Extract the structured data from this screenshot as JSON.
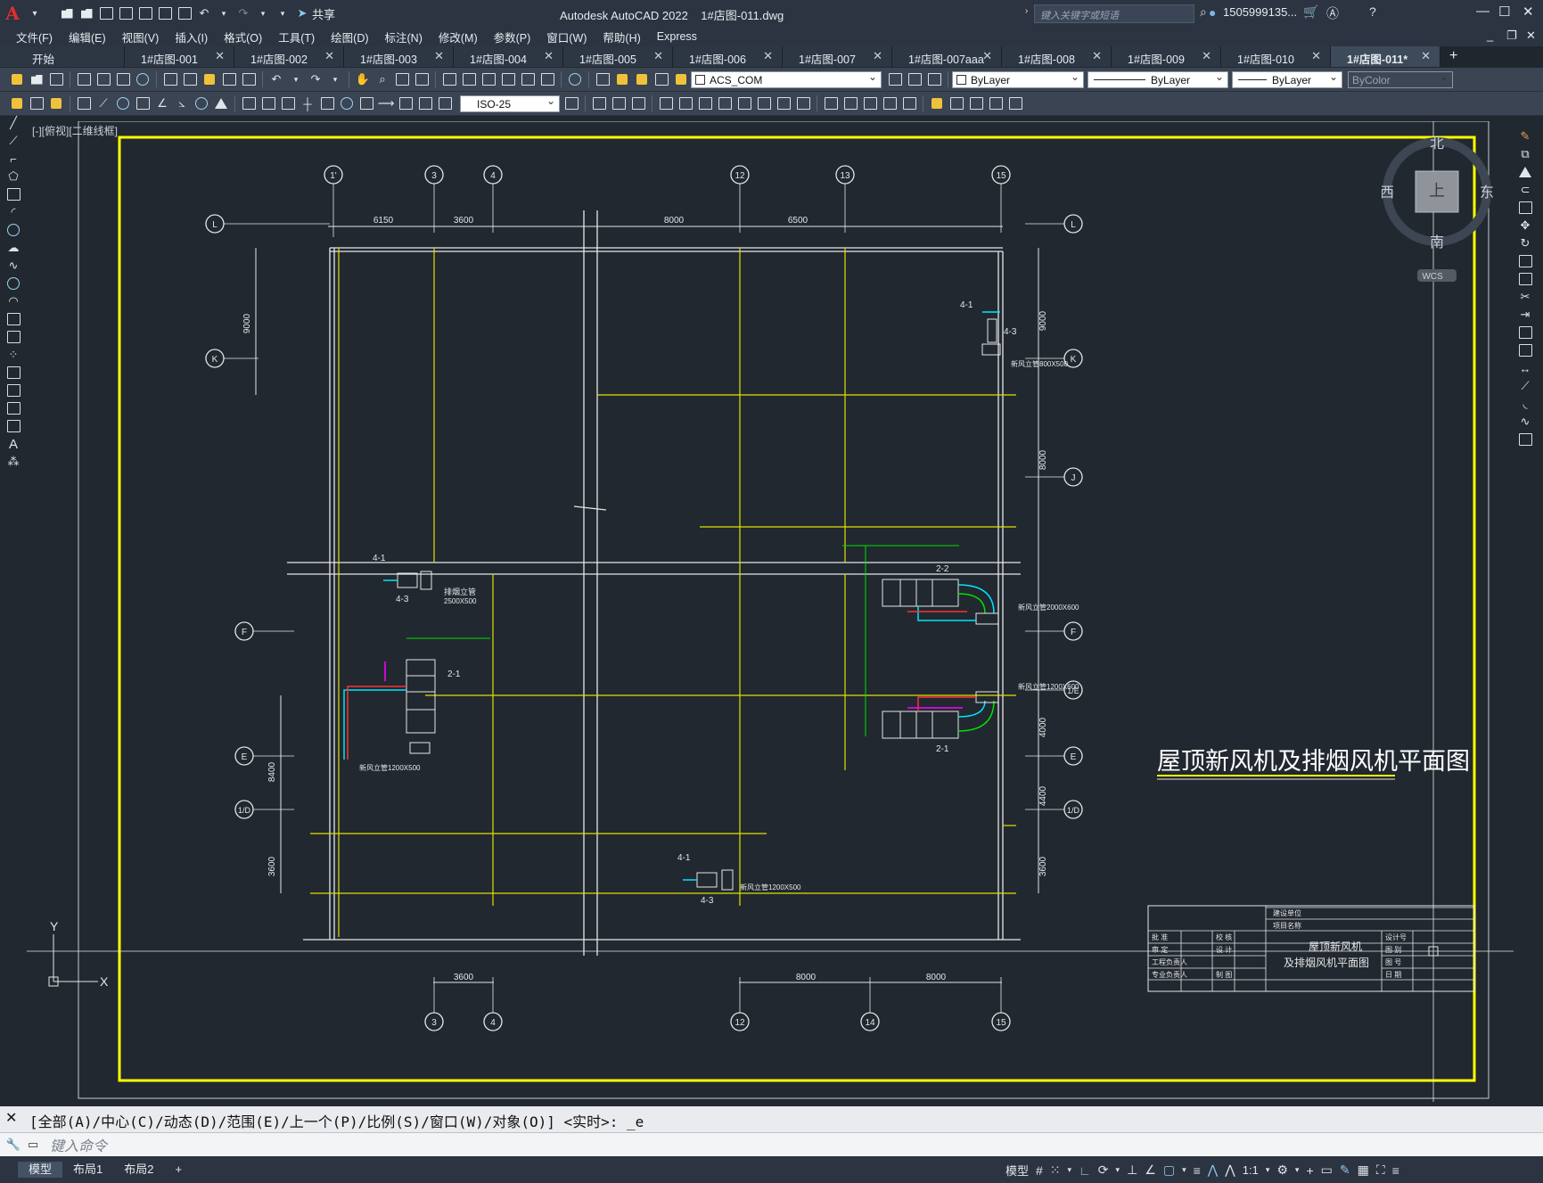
{
  "window": {
    "app_title": "Autodesk AutoCAD 2022",
    "file_title": "1#店图-011.dwg",
    "share_label": "共享",
    "search_placeholder": "键入关键字或短语",
    "user": "1505999135...",
    "logo": "A"
  },
  "menu": [
    "文件(F)",
    "编辑(E)",
    "视图(V)",
    "插入(I)",
    "格式(O)",
    "工具(T)",
    "绘图(D)",
    "标注(N)",
    "修改(M)",
    "参数(P)",
    "窗口(W)",
    "帮助(H)",
    "Express"
  ],
  "tabs": [
    {
      "label": "开始",
      "active": false
    },
    {
      "label": "1#店图-001",
      "active": false
    },
    {
      "label": "1#店图-002",
      "active": false
    },
    {
      "label": "1#店图-003",
      "active": false
    },
    {
      "label": "1#店图-004",
      "active": false
    },
    {
      "label": "1#店图-005",
      "active": false
    },
    {
      "label": "1#店图-006",
      "active": false
    },
    {
      "label": "1#店图-007",
      "active": false
    },
    {
      "label": "1#店图-007aaa",
      "active": false
    },
    {
      "label": "1#店图-008",
      "active": false
    },
    {
      "label": "1#店图-009",
      "active": false
    },
    {
      "label": "1#店图-010",
      "active": false
    },
    {
      "label": "1#店图-011*",
      "active": true
    }
  ],
  "toolbar": {
    "layer": "ACS_COM",
    "color": "ByLayer",
    "linetype": "ByLayer",
    "lineweight": "ByLayer",
    "plotstyle": "ByColor",
    "dimstyle": "ISO-25"
  },
  "viewport_label": "[-][俯视][二维线框]",
  "viewcube": {
    "north": "北",
    "south": "南",
    "east": "东",
    "west": "西",
    "top": "上",
    "wcs": "WCS"
  },
  "drawing": {
    "title": "屋顶新风机及排烟风机平面图",
    "grid_top": [
      "1'",
      "3",
      "4",
      "12",
      "13",
      "15"
    ],
    "grid_bottom": [
      "3",
      "4",
      "12",
      "14",
      "15"
    ],
    "grid_left": [
      "L",
      "K",
      "F",
      "E",
      "1/D"
    ],
    "grid_right": [
      "L",
      "K",
      "J",
      "F",
      "1/E",
      "E",
      "1/D"
    ],
    "dims_top": [
      "6150",
      "3600",
      "8000",
      "6500"
    ],
    "dims_bottom": [
      "3600",
      "8000",
      "8000"
    ],
    "dims_left": [
      "9000",
      "8400",
      "3600"
    ],
    "dims_right": [
      "9000",
      "8000",
      "4000",
      "4400",
      "3600"
    ],
    "labels": {
      "unit_a": "4-1",
      "unit_b": "4-3",
      "unit_c": "2-1",
      "unit_d": "2-2",
      "pipe_a": "排烟立管",
      "pipe_a_size": "2500X500",
      "duct_1": "新风立管1200X500",
      "duct_2": "新风立管800X500",
      "duct_3": "新风立管2000X600",
      "duct_4": "新风立管1200X600",
      "duct_5": "新风立管1200X500"
    },
    "titleblock": {
      "building_unit": "建设单位",
      "project": "项目名称",
      "name_line1": "屋顶新风机",
      "name_line2": "及排烟风机平面图",
      "rows_left": [
        "批 准",
        "审 定",
        "工程负责人",
        "专业负责人"
      ],
      "rows_mid": [
        "校 核",
        "设 计",
        "",
        "制 图"
      ],
      "rows_right": [
        "设计号",
        "图 别",
        "图 号",
        "日 期"
      ]
    }
  },
  "ucs": {
    "x": "X",
    "y": "Y"
  },
  "command": {
    "history": "[全部(A)/中心(C)/动态(D)/范围(E)/上一个(P)/比例(S)/窗口(W)/对象(O)] <实时>: _e",
    "placeholder": "键入命令"
  },
  "status": {
    "layouts": [
      "模型",
      "布局1",
      "布局2"
    ],
    "model_label": "模型",
    "scale": "1:1"
  }
}
